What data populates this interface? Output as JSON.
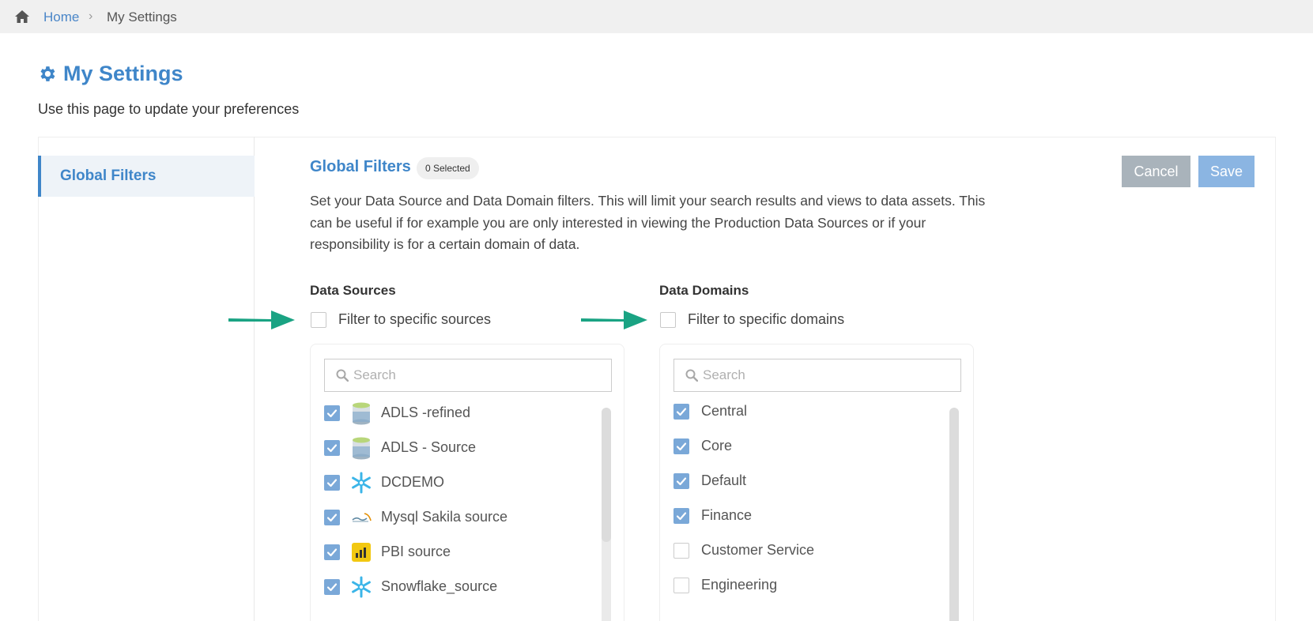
{
  "breadcrumb": {
    "home_label": "Home",
    "separator": "›",
    "current": "My Settings"
  },
  "page": {
    "title": "My Settings",
    "subtitle": "Use this page to update your preferences"
  },
  "sidebar": {
    "items": [
      {
        "label": "Global Filters",
        "active": true
      }
    ]
  },
  "global_filters": {
    "title": "Global Filters",
    "selected_badge": "0 Selected",
    "cancel_label": "Cancel",
    "save_label": "Save",
    "description": "Set your Data Source and Data Domain filters. This will limit your search results and views to data assets. This can be useful if for example you are only interested in viewing the Production Data Sources or if your responsibility is for a certain domain of data."
  },
  "data_sources": {
    "label": "Data Sources",
    "filter_label": "Filter to specific sources",
    "filter_checked": false,
    "search_placeholder": "Search",
    "items": [
      {
        "label": "ADLS -refined",
        "checked": true,
        "icon": "adls-icon"
      },
      {
        "label": "ADLS - Source",
        "checked": true,
        "icon": "adls-icon"
      },
      {
        "label": "DCDEMO",
        "checked": true,
        "icon": "snowflake-icon"
      },
      {
        "label": "Mysql Sakila source",
        "checked": true,
        "icon": "mysql-icon"
      },
      {
        "label": "PBI source",
        "checked": true,
        "icon": "powerbi-icon"
      },
      {
        "label": "Snowflake_source",
        "checked": true,
        "icon": "snowflake-icon"
      }
    ]
  },
  "data_domains": {
    "label": "Data Domains",
    "filter_label": "Filter to specific domains",
    "filter_checked": false,
    "search_placeholder": "Search",
    "items": [
      {
        "label": "Central",
        "checked": true
      },
      {
        "label": "Core",
        "checked": true
      },
      {
        "label": "Default",
        "checked": true
      },
      {
        "label": "Finance",
        "checked": true
      },
      {
        "label": "Customer Service",
        "checked": false
      },
      {
        "label": "Engineering",
        "checked": false
      }
    ]
  },
  "colors": {
    "accent": "#3f86c9",
    "checkbox_checked": "#7aa8d8",
    "arrow": "#1aa383",
    "cancel_bg": "#a9b3bb",
    "save_bg": "#8bb5e2"
  }
}
